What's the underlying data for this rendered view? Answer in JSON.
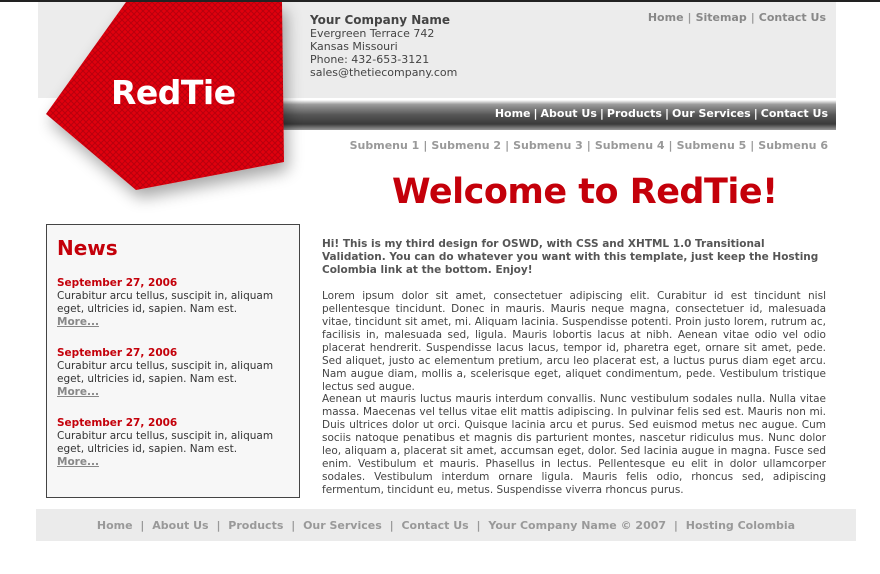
{
  "brand": {
    "logo_text": "RedTie",
    "color": "#c4000a"
  },
  "company": {
    "name": "Your Company Name",
    "address1": "Evergreen Terrace 742",
    "address2": "Kansas Missouri",
    "phone": "Phone: 432-653-3121",
    "email": "sales@thetiecompany.com"
  },
  "top_links": [
    "Home",
    "Sitemap",
    "Contact Us"
  ],
  "main_nav": [
    "Home",
    "About Us",
    "Products",
    "Our Services",
    "Contact Us"
  ],
  "submenu": [
    "Submenu 1",
    "Submenu 2",
    "Submenu 3",
    "Submenu 4",
    "Submenu 5",
    "Submenu 6"
  ],
  "welcome": "Welcome to RedTie!",
  "news": {
    "title": "News",
    "items": [
      {
        "date": "September 27, 2006",
        "text": "Curabitur arcu tellus, suscipit in, aliquam eget, ultricies id, sapien. Nam est.",
        "more": "More..."
      },
      {
        "date": "September 27, 2006",
        "text": "Curabitur arcu tellus, suscipit in, aliquam eget, ultricies id, sapien. Nam est.",
        "more": "More..."
      },
      {
        "date": "September 27, 2006",
        "text": "Curabitur arcu tellus, suscipit in, aliquam eget, ultricies id, sapien. Nam est.",
        "more": "More..."
      }
    ]
  },
  "intro": "Hi! This is my third design for OSWD, with CSS and XHTML 1.0 Transitional Validation. You can do whatever you want with this template, just keep the Hosting Colombia link at the bottom. Enjoy!",
  "paragraphs": [
    "Lorem ipsum dolor sit amet, consectetuer adipiscing elit. Curabitur id est tincidunt nisl pellentesque tincidunt. Donec in mauris. Mauris neque magna, consectetuer id, malesuada vitae, tincidunt sit amet, mi. Aliquam lacinia. Suspendisse potenti. Proin justo lorem, rutrum ac, facilisis in, malesuada sed, ligula. Mauris lobortis lacus at nibh. Aenean vitae odio vel odio placerat hendrerit. Suspendisse lacus lacus, tempor id, pharetra eget, ornare sit amet, pede. Sed aliquet, justo ac elementum pretium, arcu leo placerat est, a luctus purus diam eget arcu. Nam augue diam, mollis a, scelerisque eget, aliquet condimentum, pede. Vestibulum tristique lectus sed augue.",
    "Aenean ut mauris luctus mauris interdum convallis. Nunc vestibulum sodales nulla. Nulla vitae massa. Maecenas vel tellus vitae elit mattis adipiscing. In pulvinar felis sed est. Mauris non mi. Duis ultrices dolor ut orci. Quisque lacinia arcu et purus. Sed euismod metus nec augue. Cum sociis natoque penatibus et magnis dis parturient montes, nascetur ridiculus mus. Nunc dolor leo, aliquam a, placerat sit amet, accumsan eget, dolor. Sed lacinia augue in magna. Fusce sed enim. Vestibulum et mauris. Phasellus in lectus. Pellentesque eu elit in dolor ullamcorper sodales. Vestibulum interdum ornare ligula. Mauris felis odio, rhoncus sed, adipiscing fermentum, tincidunt eu, metus. Suspendisse viverra rhoncus purus."
  ],
  "footer": {
    "links": [
      "Home",
      "About Us",
      "Products",
      "Our Services",
      "Contact Us"
    ],
    "copyright": "Your Company Name © 2007",
    "credit": "Hosting Colombia"
  }
}
